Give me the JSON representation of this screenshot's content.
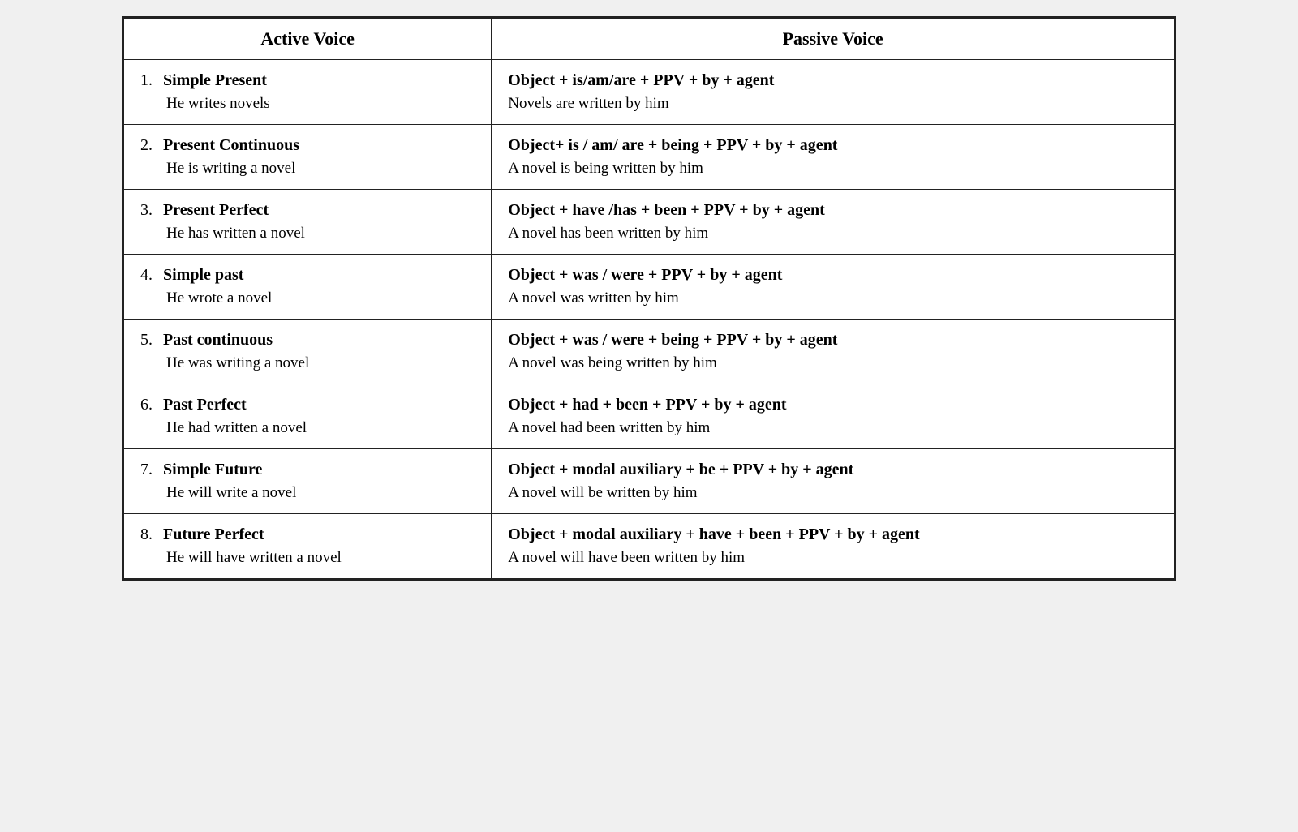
{
  "headers": {
    "active": "Active Voice",
    "passive": "Passive Voice"
  },
  "rows": [
    {
      "number": "1.",
      "tense": "Simple Present",
      "active_example": "He writes novels",
      "passive_formula": "Object + is/am/are + PPV + by + agent",
      "passive_example": "Novels are written by him"
    },
    {
      "number": "2.",
      "tense": "Present Continuous",
      "active_example": "He is writing a novel",
      "passive_formula": "Object+ is / am/ are + being + PPV + by + agent",
      "passive_example": "A novel is being written by him"
    },
    {
      "number": "3.",
      "tense": "Present Perfect",
      "active_example": "He has written a novel",
      "passive_formula": "Object + have /has + been + PPV + by + agent",
      "passive_example": "A novel has been written by him"
    },
    {
      "number": "4.",
      "tense": "Simple past",
      "active_example": "He wrote a novel",
      "passive_formula": "Object + was / were + PPV + by + agent",
      "passive_example": "A novel was written by him"
    },
    {
      "number": "5.",
      "tense": "Past continuous",
      "active_example": "He was writing a novel",
      "passive_formula": "Object + was / were + being + PPV + by + agent",
      "passive_example": "A novel was  being written by him"
    },
    {
      "number": "6.",
      "tense": "Past Perfect",
      "active_example": "He had written a novel",
      "passive_formula": "Object + had + been + PPV + by + agent",
      "passive_example": "A novel had been written by him"
    },
    {
      "number": "7.",
      "tense": "Simple Future",
      "active_example": "He will write a novel",
      "passive_formula": "Object + modal auxiliary + be + PPV + by + agent",
      "passive_example": "A novel will be written by him"
    },
    {
      "number": "8.",
      "tense": "Future Perfect",
      "active_example": "He will have written a novel",
      "passive_formula": "Object + modal auxiliary +  have + been + PPV + by + agent",
      "passive_example": "A novel will have been written by him"
    }
  ]
}
